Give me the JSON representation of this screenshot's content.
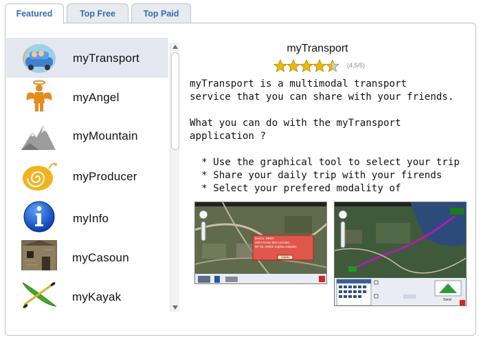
{
  "tabs": [
    {
      "label": "Featured",
      "active": true
    },
    {
      "label": "Top Free",
      "active": false
    },
    {
      "label": "Top Paid",
      "active": false
    }
  ],
  "apps": [
    {
      "name": "myTransport",
      "icon": "car-family-icon",
      "selected": true
    },
    {
      "name": "myAngel",
      "icon": "angel-figure-icon",
      "selected": false
    },
    {
      "name": "myMountain",
      "icon": "mountain-icon",
      "selected": false
    },
    {
      "name": "myProducer",
      "icon": "snail-spiral-icon",
      "selected": false
    },
    {
      "name": "myInfo",
      "icon": "info-circle-icon",
      "selected": false
    },
    {
      "name": "myCasoun",
      "icon": "stone-house-icon",
      "selected": false
    },
    {
      "name": "myKayak",
      "icon": "kayak-icon",
      "selected": false
    }
  ],
  "detail": {
    "title": "myTransport",
    "rating": 4.5,
    "rating_max": 5,
    "rating_text": "(4,5/5)",
    "description_lines": [
      "myTransport is a multimodal transport",
      "service that you can share with your friends.",
      "",
      "What you can do with the myTransport",
      "application ?",
      "",
      "  * Use the graphical tool to select your trip",
      "  * Share your daily trip with your firends",
      "  * Select your prefered modality of"
    ],
    "screenshots": [
      {
        "name": "map-satellite-screenshot",
        "popup_lines": [
          "End to: INRIA",
          "2004 Route des Lucioles,",
          "BP 93, 06902 Sophia Antipolis"
        ],
        "popup_button": "Validate"
      },
      {
        "name": "route-calendar-screenshot",
        "send_label": "Send"
      }
    ]
  },
  "colors": {
    "tab_text": "#2f6fb7",
    "selected_row": "#e4e6f0",
    "star": "#f2b705",
    "border": "#b8c4d0"
  }
}
